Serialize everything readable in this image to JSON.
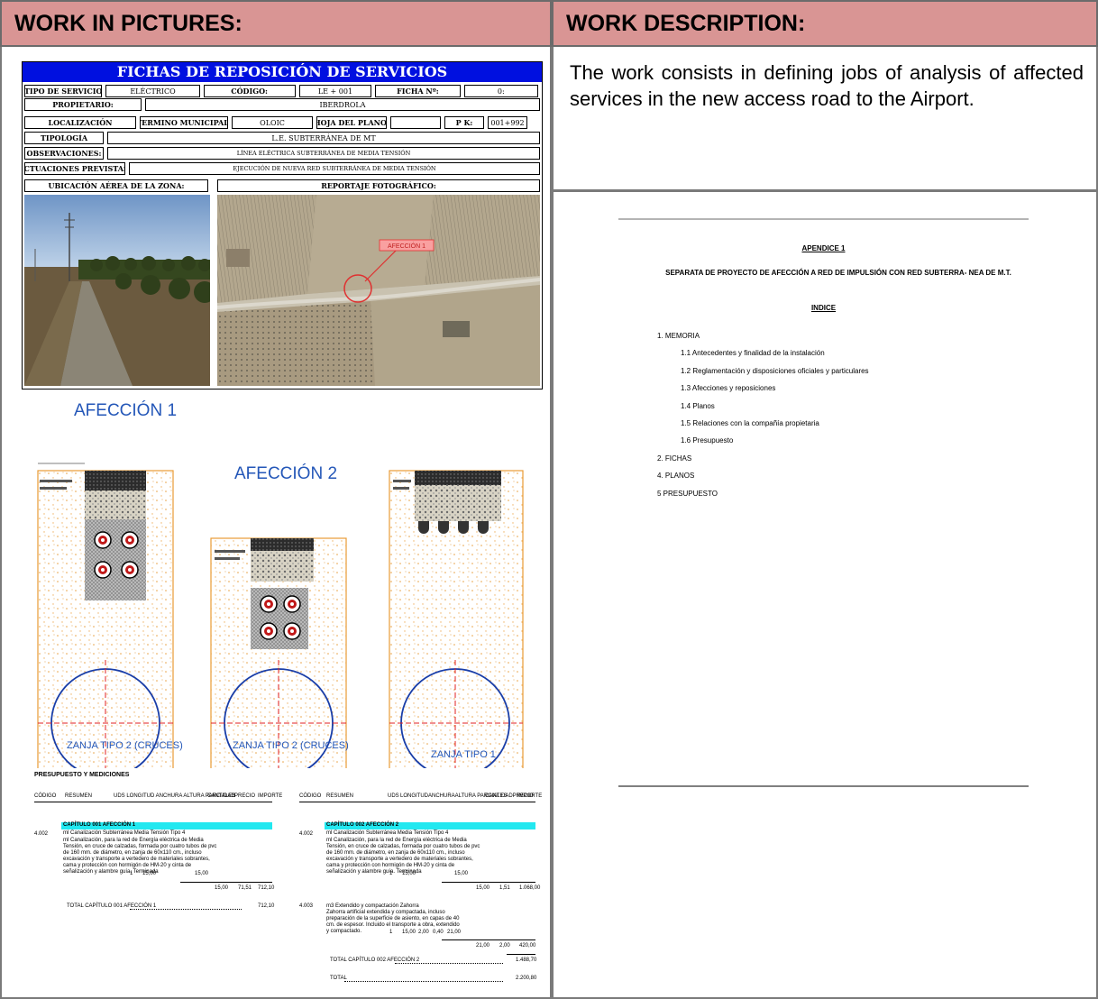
{
  "header": {
    "left_title": "WORK IN PICTURES:",
    "right_title": "WORK DESCRIPTION:"
  },
  "description": "The work consists in defining jobs of analysis of affected services in the new access road to the Airport.",
  "ficha": {
    "title": "FICHAS DE REPOSICIÓN DE SERVICIOS",
    "tipo_label": "TIPO DE SERVICIO",
    "tipo_value": "ELÉCTRICO",
    "codigo_label": "CÓDIGO:",
    "codigo_value": "LE + 001",
    "ficha_label": "FICHA Nº:",
    "ficha_value": "0:",
    "propietario_label": "PROPIETARIO:",
    "propietario_value": "IBERDROLA",
    "localizacion_label": "LOCALIZACIÓN",
    "termino_label": "TERMINO MUNICIPAL:",
    "termino_value": "OLOIC",
    "hoja_label": "HOJA DEL PLANO:",
    "pk_label": "P K:",
    "pk_value": "001+992",
    "tipologia_label": "TIPOLOGÍA",
    "tipologia_value": "L.E. SUBTERRÁNEA DE MT",
    "observaciones_label": "OBSERVACIONES:",
    "observaciones_value": "LÍNEA ELÉCTRICA SUBTERRÁNEA DE MEDIA TENSIÓN",
    "actuaciones_label": "ACTUACIONES PREVISTAS:",
    "actuaciones_value": "EJECUCIÓN DE NUEVA RED SUBTERRÁNEA DE MEDIA TENSIÓN",
    "ubicacion_label": "UBICACIÓN AÉREA DE LA ZONA:",
    "reportaje_label": "REPORTAJE FOTOGRÁFICO:",
    "map_label": "AFECCIÓN 1"
  },
  "drawings": {
    "title_1": "AFECCIÓN 1",
    "title_2": "AFECCIÓN 2",
    "caption_1": "ZANJA TIPO 2 (CRUCES)",
    "caption_2": "ZANJA TIPO 2 (CRUCES)",
    "caption_3": "ZANJA TIPO 1"
  },
  "budget": {
    "heading": "PRESUPUESTO Y MEDICIONES",
    "cols_left": [
      "CÓDIGO",
      "RESUMEN",
      "UDS LONGITUD ANCHURA ALTURA PARCIALES",
      "CANTIDAD",
      "PRECIO",
      "IMPORTE"
    ],
    "cols_right": [
      "CÓDIGO",
      "RESUMEN",
      "UDS",
      "LONGITUDANCHURAALTURA PARCIALES",
      "CANTIDADPRECIO",
      "IMPORTE"
    ],
    "chapter_1": "CAPÍTULO 001 AFECCIÓN 1",
    "chapter_2": "CAPÍTULO 002 AFECCIÓN 2",
    "code_1": "4.002",
    "code_2": "4.002",
    "code_3": "4.003",
    "item_title": "ml  Canalización Subterránea Media Tensión Tipo 4",
    "item_desc": "ml Canalización, para la red de Energía eléctrica de Media Tensión, en cruce de calzadas, formada por cuatro tubos de pvc de 160 mm. de diámetro, en zanja de 60x110 cm., incluso excavación y transporte a vertedero de materiales sobrantes, cama y protección con hormigón de HM-20 y cinta de señalización y alambre guía. Terminada",
    "item3_title": "m3  Extendido y compactación Zahorra",
    "item3_desc": "Zahorra artificial extendida y compactada, incluso preparación de la superficie de asiento, en capas de 40 cm. de espesor. Incluido el transporte a obra, extendido y compactado.",
    "row_l": [
      "1",
      "15,00",
      "15,00"
    ],
    "row_l_total": [
      "15,00",
      "71,51",
      "712,10"
    ],
    "total_1": "TOTAL CAPÍTULO 001 AFECCIÓN 1",
    "total_1_value": "712,10",
    "row_r": [
      "1",
      "15,00",
      "15,00"
    ],
    "row_r_total": [
      "15,00",
      "1,51",
      "1.068,00"
    ],
    "row_r3": [
      "1",
      "15,00",
      "2,00",
      "0,40",
      "21,00"
    ],
    "row_r3_total": [
      "21,00",
      "2,00",
      "420,00"
    ],
    "total_2": "TOTAL CAPÍTULO 002 AFECCIÓN 2",
    "total_2_value": "1.488,70",
    "grand_label": "TOTAL",
    "grand_value": "2.200,80"
  },
  "appendix": {
    "title": "APENDICE 1",
    "subtitle": "SEPARATA DE PROYECTO DE AFECCIÓN A RED DE IMPULSIÓN CON RED SUBTERRA- NEA DE M.T.",
    "index_title": "INDICE",
    "toc": [
      {
        "text": "1. MEMORIA",
        "level": 0
      },
      {
        "text": "1.1 Antecedentes y finalidad de la instalación",
        "level": 1
      },
      {
        "text": "1.2 Reglamentación y disposiciones oficiales y particulares",
        "level": 1
      },
      {
        "text": "1.3 Afecciones y reposiciones",
        "level": 1
      },
      {
        "text": "1.4 Planos",
        "level": 1
      },
      {
        "text": "1.5 Relaciones con la compañía propietaria",
        "level": 1
      },
      {
        "text": "1.6 Presupuesto",
        "level": 1
      },
      {
        "text": "2. FICHAS",
        "level": 0
      },
      {
        "text": "4. PLANOS",
        "level": 0
      },
      {
        "text": "5 PRESUPUESTO",
        "level": 0
      }
    ]
  }
}
